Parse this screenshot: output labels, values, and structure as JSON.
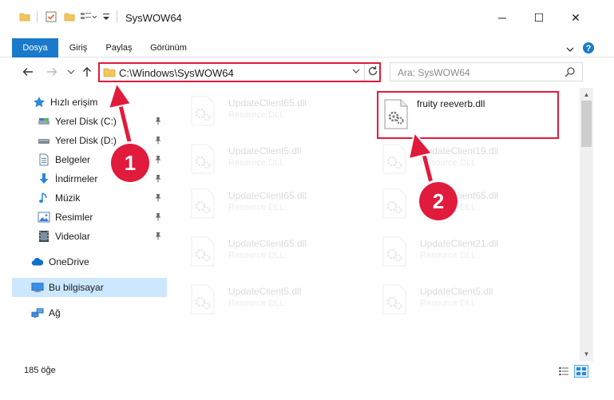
{
  "window": {
    "title": "SysWOW64",
    "minimize_glyph": "─",
    "maximize_glyph": "☐",
    "close_glyph": "✕"
  },
  "ribbon": {
    "tabs": [
      {
        "label": "Dosya",
        "active": true
      },
      {
        "label": "Giriş"
      },
      {
        "label": "Paylaş"
      },
      {
        "label": "Görünüm"
      }
    ]
  },
  "address": {
    "path": "C:\\Windows\\SysWOW64"
  },
  "search": {
    "placeholder": "Ara: SysWOW64"
  },
  "sidebar": {
    "items": [
      {
        "label": "Hızlı erişim",
        "icon": "star-icon"
      },
      {
        "label": "Yerel Disk (C:)",
        "icon": "drive-icon",
        "pinned": true
      },
      {
        "label": "Yerel Disk (D:)",
        "icon": "drive-icon",
        "pinned": true
      },
      {
        "label": "Belgeler",
        "icon": "documents-icon",
        "pinned": true
      },
      {
        "label": "İndirmeler",
        "icon": "download-icon",
        "pinned": true
      },
      {
        "label": "Müzik",
        "icon": "music-icon",
        "pinned": true
      },
      {
        "label": "Resimler",
        "icon": "pictures-icon",
        "pinned": true
      },
      {
        "label": "Videolar",
        "icon": "videos-icon",
        "pinned": true
      },
      {
        "label": "OneDrive",
        "icon": "cloud-icon"
      },
      {
        "label": "Bu bilgisayar",
        "icon": "computer-icon",
        "selected": true
      },
      {
        "label": "Ağ",
        "icon": "network-icon"
      }
    ]
  },
  "files": [
    {
      "name": "UpdateClient65.dll",
      "type": "Resource DLL",
      "faded": true
    },
    {
      "name": "fruity reeverb.dll",
      "type": "",
      "highlight": true
    },
    {
      "name": "UpdateClient5.dll",
      "type": "Resource DLL",
      "faded": true
    },
    {
      "name": "UpdateClient19.dll",
      "type": "Resource DLL",
      "faded": true
    },
    {
      "name": "UpdateClient65.dll",
      "type": "Resource DLL",
      "faded": true
    },
    {
      "name": "UpdateClient65.dll",
      "type": "Resource DLL",
      "faded": true
    },
    {
      "name": "UpdateClient65.dll",
      "type": "Resource DLL",
      "faded": true
    },
    {
      "name": "UpdateClient21.dll",
      "type": "Resource DLL",
      "faded": true
    },
    {
      "name": "UpdateClient5.dll",
      "type": "Resource DLL",
      "faded": true
    },
    {
      "name": "UpdateClient5.dll",
      "type": "Resource DLL",
      "faded": true
    }
  ],
  "status": {
    "item_count": "185 öğe"
  },
  "markers": [
    {
      "label": "1"
    },
    {
      "label": "2"
    }
  ],
  "colors": {
    "accent": "#1979ca",
    "highlight": "#e11b3c",
    "selected": "#cce8ff"
  }
}
